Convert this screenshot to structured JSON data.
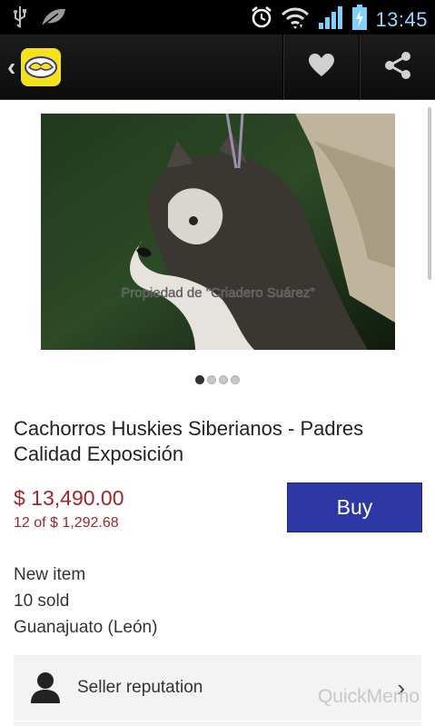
{
  "status_bar": {
    "time": "13:45",
    "icons": [
      "usb-icon",
      "leaf-icon",
      "alarm-icon",
      "wifi-icon",
      "signal-icon",
      "battery-charging-icon"
    ],
    "time_color": "#8fd9ff"
  },
  "action_bar": {
    "icons": [
      "back-chevron-icon",
      "app-logo",
      "heart-icon",
      "share-icon"
    ]
  },
  "product": {
    "image_watermark": "Propiedad de \"Criadero Suárez\"",
    "pager": {
      "total": 4,
      "current": 1
    },
    "title": "Cachorros Huskies Siberianos - Padres Calidad Exposición",
    "price": "$ 13,490.00",
    "installments_count": "12",
    "installments_of": " of ",
    "installments_amount": "$ 1,292.68",
    "buy_label": "Buy",
    "condition": "New item",
    "sold": "10 sold",
    "location": "Guanajuato (León)"
  },
  "seller": {
    "label": "Seller reputation"
  },
  "overlay": {
    "watermark": "QuickMemo"
  },
  "colors": {
    "price": "#a3262a",
    "buy_button": "#2d38a5",
    "logo": "#f5e31a"
  }
}
